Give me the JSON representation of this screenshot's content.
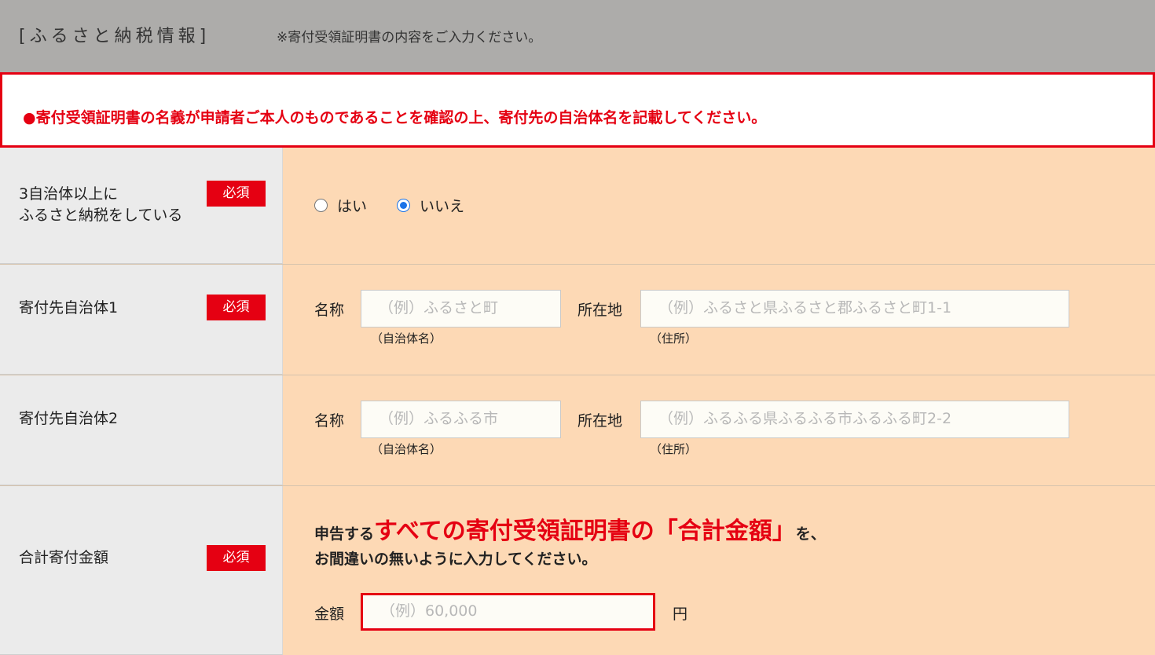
{
  "header": {
    "title": "[ふるさと納税情報]",
    "note": "※寄付受領証明書の内容をご入力ください。"
  },
  "notice": {
    "text": "●寄付受領証明書の名義が申請者ご本人のものであることを確認の上、寄付先の自治体名を記載してください。"
  },
  "required_badge": "必須",
  "rows": {
    "multi": {
      "label_line1": "3自治体以上に",
      "label_line2": "ふるさと納税をしている",
      "options": [
        "はい",
        "いいえ"
      ],
      "selected": "いいえ"
    },
    "muni1": {
      "label": "寄付先自治体1",
      "name_label": "名称",
      "name_placeholder": "（例）ふるさと町",
      "name_sub": "（自治体名）",
      "addr_label": "所在地",
      "addr_placeholder": "（例）ふるさと県ふるさと郡ふるさと町1-1",
      "addr_sub": "（住所）"
    },
    "muni2": {
      "label": "寄付先自治体2",
      "name_label": "名称",
      "name_placeholder": "（例）ふるふる市",
      "name_sub": "（自治体名）",
      "addr_label": "所在地",
      "addr_placeholder": "（例）ふるふる県ふるふる市ふるふる町2-2",
      "addr_sub": "（住所）"
    },
    "total": {
      "label": "合計寄付金額",
      "msg_prefix": "申告する",
      "msg_emphasis": "すべての寄付受領証明書の「合計金額」",
      "msg_suffix": "を、",
      "msg_line2": "お間違いの無いように入力してください。",
      "amount_label": "金額",
      "amount_placeholder": "（例）60,000",
      "unit": "円"
    }
  },
  "colors": {
    "accent_red": "#e50012",
    "content_bg": "#fdd9b5",
    "label_bg": "#ebebeb",
    "header_bg": "#adacaa",
    "radio_blue": "#1a73e8"
  }
}
